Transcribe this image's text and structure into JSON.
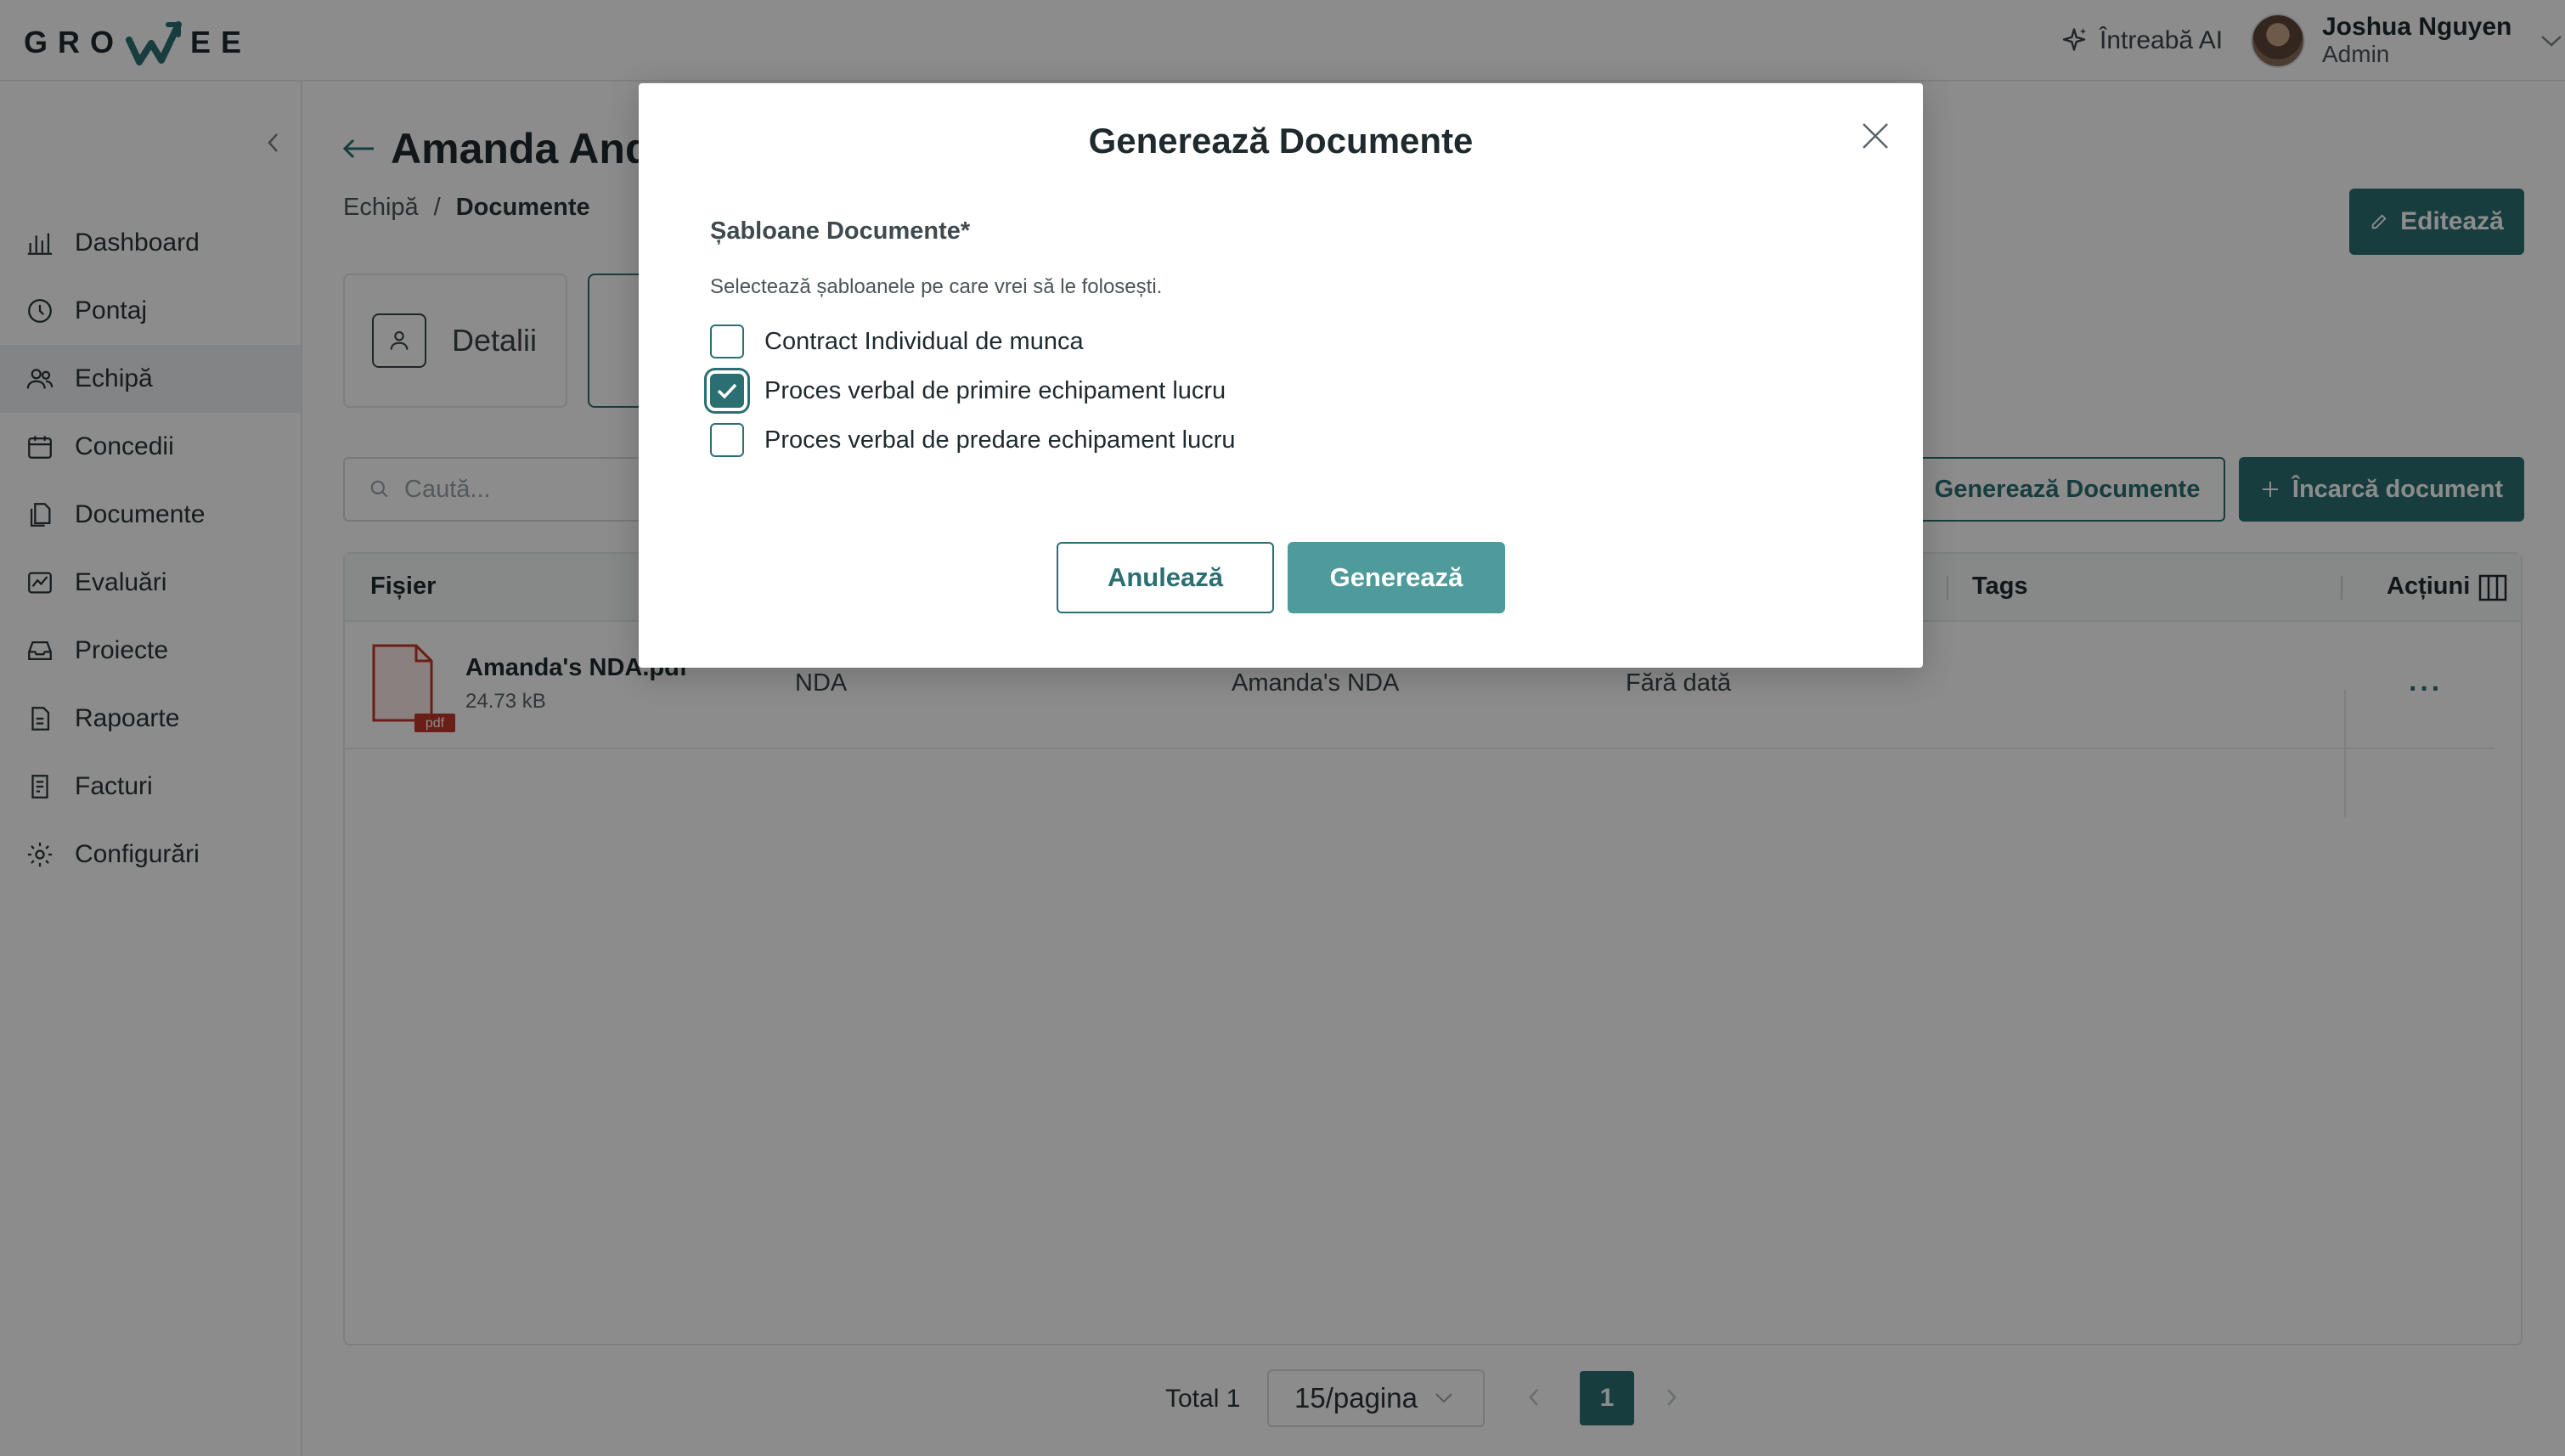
{
  "header": {
    "logo_text_left": "GRO",
    "logo_text_right": "EE",
    "ask_ai_label": "Întreabă AI",
    "user_name": "Joshua Nguyen",
    "user_role": "Admin"
  },
  "sidebar": {
    "items": [
      {
        "label": "Dashboard",
        "icon": "chart-bars-icon",
        "active": false
      },
      {
        "label": "Pontaj",
        "icon": "clock-icon",
        "active": false
      },
      {
        "label": "Echipă",
        "icon": "users-icon",
        "active": true
      },
      {
        "label": "Concedii",
        "icon": "calendar-icon",
        "active": false
      },
      {
        "label": "Documente",
        "icon": "documents-icon",
        "active": false
      },
      {
        "label": "Evaluări",
        "icon": "chart-line-icon",
        "active": false
      },
      {
        "label": "Proiecte",
        "icon": "inbox-icon",
        "active": false
      },
      {
        "label": "Rapoarte",
        "icon": "report-icon",
        "active": false
      },
      {
        "label": "Facturi",
        "icon": "invoice-icon",
        "active": false
      },
      {
        "label": "Configurări",
        "icon": "gear-icon",
        "active": false
      }
    ]
  },
  "page": {
    "title": "Amanda Ande",
    "breadcrumb": [
      "Echipă",
      "Documente"
    ],
    "edit_label": "Editează",
    "tabs": [
      "Detalii"
    ],
    "search_placeholder": "Caută...",
    "generate_docs_label": "Generează Documente",
    "upload_label": "Încarcă document"
  },
  "table": {
    "columns": [
      "Fișier",
      "Tags",
      "Acțiuni"
    ],
    "rows": [
      {
        "file_name": "Amanda's NDA.pdf",
        "file_size": "24.73 kB",
        "file_ext": "pdf",
        "type": "NDA",
        "title": "Amanda's NDA",
        "date": "Fără dată",
        "actions": "···"
      }
    ]
  },
  "pagination": {
    "total_label": "Total 1",
    "per_page": "15/pagina",
    "current_page": "1"
  },
  "modal": {
    "title": "Generează Documente",
    "field_label": "Șabloane Documente*",
    "field_hint": "Selectează șabloanele pe care vrei să le folosești.",
    "options": [
      {
        "label": "Contract Individual de munca",
        "checked": false
      },
      {
        "label": "Proces verbal de primire echipament lucru",
        "checked": true
      },
      {
        "label": "Proces verbal de predare echipament lucru",
        "checked": false
      }
    ],
    "cancel_label": "Anulează",
    "submit_label": "Generează"
  },
  "colors": {
    "primary": "#2b6f72",
    "primary_light": "#4f9b9c",
    "pdf_red": "#c0392b"
  }
}
